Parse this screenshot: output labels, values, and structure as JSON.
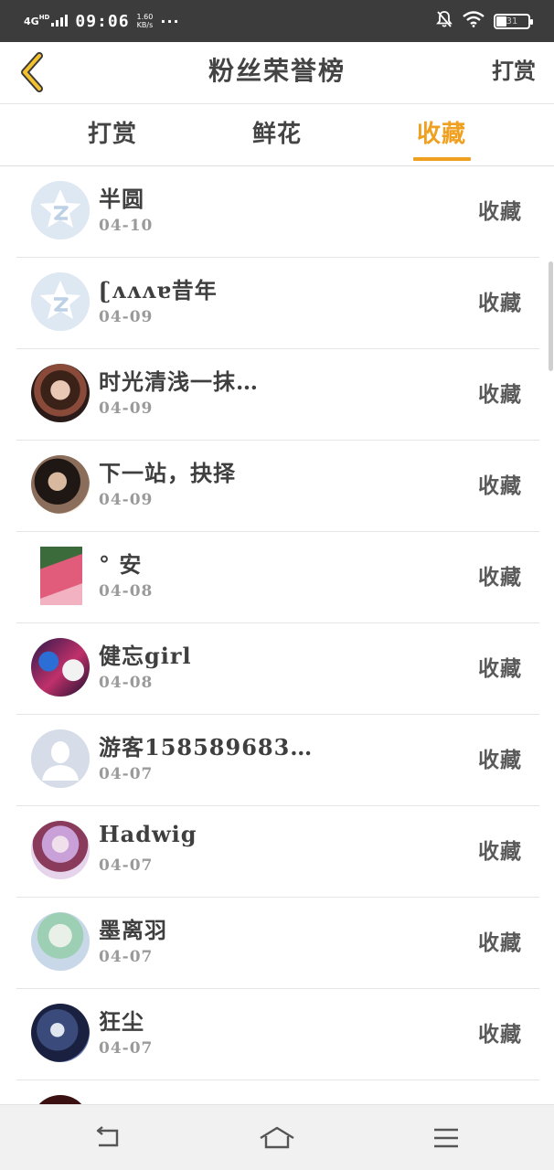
{
  "status_bar": {
    "network": "4G",
    "network_sub": "HD",
    "time": "09:06",
    "speed_value": "1.60",
    "speed_unit": "KB/s",
    "more": "···",
    "battery": "31",
    "icons": [
      "signal-icon",
      "mute-notification-icon",
      "wifi-icon",
      "battery-icon"
    ]
  },
  "header": {
    "back_icon": "chevron-left-icon",
    "title": "粉丝荣誉榜",
    "action_label": "打赏"
  },
  "tabs": [
    {
      "label": "打赏",
      "active": false
    },
    {
      "label": "鲜花",
      "active": false
    },
    {
      "label": "收藏",
      "active": true
    }
  ],
  "accent_color": "#f0a020",
  "fans": [
    {
      "name": "半圆",
      "date": "04-10",
      "action": "收藏",
      "avatar": "qq-default-avatar"
    },
    {
      "name": "ʗᴧᴧᴧɐ昔年",
      "date": "04-09",
      "action": "收藏",
      "avatar": "qq-default-avatar"
    },
    {
      "name": "时光清浅一抹…",
      "date": "04-09",
      "action": "收藏",
      "avatar": "photo-avatar"
    },
    {
      "name": "下一站，抉择",
      "date": "04-09",
      "action": "收藏",
      "avatar": "photo-avatar"
    },
    {
      "name": "° 安",
      "date": "04-08",
      "action": "收藏",
      "avatar": "photo-avatar"
    },
    {
      "name": "健忘girl",
      "date": "04-08",
      "action": "收藏",
      "avatar": "photo-avatar"
    },
    {
      "name": "游客158589683…",
      "date": "04-07",
      "action": "收藏",
      "avatar": "blank-person-avatar"
    },
    {
      "name": "Hadwig",
      "date": "04-07",
      "action": "收藏",
      "avatar": "photo-avatar"
    },
    {
      "name": "墨离羽",
      "date": "04-07",
      "action": "收藏",
      "avatar": "photo-avatar"
    },
    {
      "name": "狂尘",
      "date": "04-07",
      "action": "收藏",
      "avatar": "photo-avatar"
    }
  ],
  "navbar": {
    "icons": [
      "nav-back-icon",
      "nav-home-icon",
      "nav-menu-icon"
    ]
  }
}
